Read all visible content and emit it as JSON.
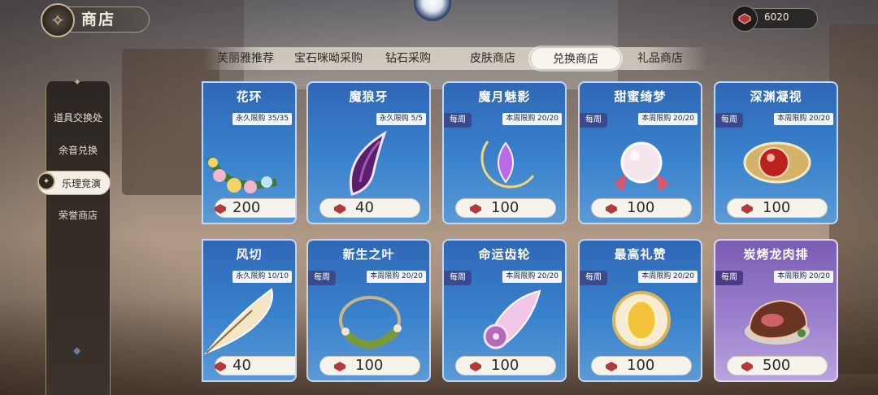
{
  "header": {
    "title": "商店",
    "currency_value": "6020"
  },
  "tabs": [
    {
      "label": "芙丽雅推荐",
      "active": false
    },
    {
      "label": "宝石咪呦采购",
      "active": false
    },
    {
      "label": "钻石采购",
      "active": false
    },
    {
      "label": "皮肤商店",
      "active": false
    },
    {
      "label": "兑换商店",
      "active": true
    },
    {
      "label": "礼品商店",
      "active": false
    }
  ],
  "sidebar": {
    "items": [
      {
        "label": "道具交换处",
        "active": false
      },
      {
        "label": "余音兑换",
        "active": false
      },
      {
        "label": "乐理竞演",
        "active": true
      },
      {
        "label": "荣誉商店",
        "active": false
      }
    ]
  },
  "cards": [
    {
      "name": "花环",
      "weekly": "",
      "limit": "永久限购 35/35",
      "price": "200",
      "icon": "flower-wreath-icon"
    },
    {
      "name": "魔狼牙",
      "weekly": "",
      "limit": "永久限购 5/5",
      "price": "40",
      "icon": "wolf-fang-icon"
    },
    {
      "name": "魔月魅影",
      "weekly": "每周",
      "limit": "本周限购 20/20",
      "price": "100",
      "icon": "moon-gem-icon"
    },
    {
      "name": "甜蜜绮梦",
      "weekly": "每周",
      "limit": "本周限购 20/20",
      "price": "100",
      "icon": "candy-icon"
    },
    {
      "name": "深渊凝视",
      "weekly": "每周",
      "limit": "本周限购 20/20",
      "price": "100",
      "icon": "red-eye-gem-icon"
    },
    {
      "name": "风切",
      "weekly": "",
      "limit": "永久限购 10/10",
      "price": "40",
      "icon": "quill-icon"
    },
    {
      "name": "新生之叶",
      "weekly": "每周",
      "limit": "本周限购 20/20",
      "price": "100",
      "icon": "leaf-bracelet-icon"
    },
    {
      "name": "命运齿轮",
      "weekly": "每周",
      "limit": "本周限购 20/20",
      "price": "100",
      "icon": "gear-wing-icon"
    },
    {
      "name": "最高礼赞",
      "weekly": "每周",
      "limit": "本周限购 20/20",
      "price": "100",
      "icon": "gold-medal-icon"
    },
    {
      "name": "炭烤龙肉排",
      "weekly": "每周",
      "limit": "本周限购 20/20",
      "price": "500",
      "icon": "steak-icon"
    }
  ],
  "colors": {
    "card_blue": "#3a82cc",
    "card_purple": "#9a7fcc",
    "price_gem": "#b23a3a"
  }
}
